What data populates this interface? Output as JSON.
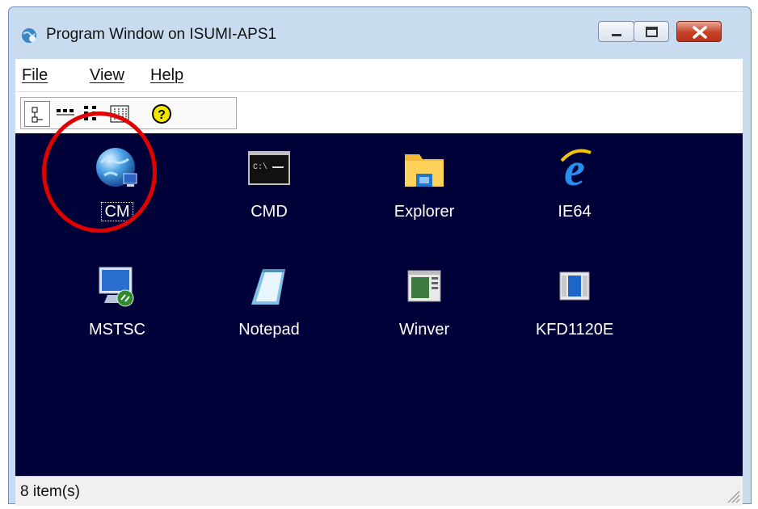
{
  "window": {
    "title": "Program Window on ISUMI-APS1"
  },
  "menu": {
    "file": "File",
    "view": "View",
    "help": "Help"
  },
  "toolbar": {
    "buttons": [
      "large-icons-view",
      "small-icons-view",
      "list-view",
      "details-view",
      "help-icon"
    ]
  },
  "icons": [
    {
      "label": "CM",
      "icon": "globe-network-icon",
      "selected": true
    },
    {
      "label": "CMD",
      "icon": "command-prompt-icon"
    },
    {
      "label": "Explorer",
      "icon": "folder-explorer-icon"
    },
    {
      "label": "IE64",
      "icon": "internet-explorer-icon"
    },
    {
      "label": "MSTSC",
      "icon": "remote-desktop-icon"
    },
    {
      "label": "Notepad",
      "icon": "notepad-icon"
    },
    {
      "label": "Winver",
      "icon": "winver-icon"
    },
    {
      "label": "KFD1120E",
      "icon": "kfd-window-icon"
    }
  ],
  "status": {
    "text": "8 item(s)"
  },
  "colors": {
    "content_bg": "#000038",
    "highlight": "#e00000",
    "accent": "#1e66c8"
  }
}
